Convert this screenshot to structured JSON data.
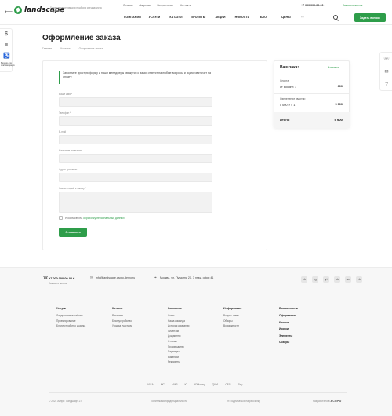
{
  "header": {
    "back_arrow": "⟵",
    "logo_text": "landscape",
    "tagline": "Готовые решения для подбора специалиста по дизайну",
    "top_links": [
      "Отзывы",
      "Лицензии",
      "Вопрос-ответ",
      "Контакты"
    ],
    "phone": "+7 000 000-00-00 ▾",
    "callback": "Заказать звонок",
    "nav": [
      "КОМПАНИЯ",
      "УСЛУГИ",
      "КАТАЛОГ",
      "ПРОЕКТЫ",
      "АКЦИИ",
      "НОВОСТИ",
      "БЛОГ",
      "ЦЕНЫ",
      "···"
    ],
    "order_button": "Задать вопрос"
  },
  "side_tools": {
    "left": [
      {
        "icon": "currency-icon",
        "glyph": "$"
      },
      {
        "icon": "filter-icon",
        "glyph": "≡"
      },
      {
        "icon": "accessibility-icon",
        "glyph": "♿"
      }
    ],
    "left_label": "Версия для слабовидящих"
  },
  "page": {
    "title": "Оформление заказа",
    "breadcrumb": [
      "Главная",
      "—",
      "Корзина",
      "—",
      "Оформление заказа"
    ]
  },
  "form": {
    "intro": "Заполните простую форму и наши менеджеры свяжутся с вами, ответят на любые вопросы и подготовят счет на оплату.",
    "fields": [
      {
        "label": "Ваше имя *"
      },
      {
        "label": "Телефон *"
      },
      {
        "label": "E-mail"
      },
      {
        "label": "Название компании"
      },
      {
        "label": "Адрес доставки"
      },
      {
        "label": "Комментарий к заказу *"
      }
    ],
    "consent_prefix": "Я согласен на",
    "consent_link": "обработку персональных данных",
    "submit": "Отправить"
  },
  "summary": {
    "title": "Ваш заказ",
    "edit": "Изменить",
    "items": [
      {
        "name": "Спорта",
        "qty": "от 600 ₽ × 1",
        "price": "600"
      },
      {
        "name": "Озеленение квартир",
        "qty": "5 000 ₽ × 1",
        "price": "5 000"
      }
    ],
    "total_label": "Итого:",
    "total_value": "5 600"
  },
  "footer": {
    "phone": "+7 000 000-00-00 ▾",
    "callback": "Заказать звонок",
    "email": "info@landscape.aspro-demo.ru",
    "address": "Москва, ул. Пушкина 21, 3 этаж, офис 41",
    "socials": [
      "vk",
      "tg",
      "yt",
      "ok",
      "wa",
      "vb"
    ],
    "columns": [
      {
        "title": "Услуги",
        "links": [
          "Ландшафтные работы",
          "Проектирование",
          "Благоустройство участка"
        ]
      },
      {
        "title": "Каталог",
        "links": [
          "Растения",
          "Благоустройство",
          "Уход за участком"
        ]
      },
      {
        "title": "Компания",
        "links": [
          "О нас",
          "Наша команда",
          "История компании",
          "Лицензии",
          "Документы",
          "Отзывы",
          "Производство",
          "Партнеры",
          "Вакансии",
          "Реквизиты"
        ]
      },
      {
        "title": "Информация",
        "links": [
          "Вопрос-ответ",
          "Обзоры",
          "Возможности"
        ]
      },
      {
        "title": "Возможности",
        "links": [
          "Оформление",
          "Кнопки",
          "Иконки",
          "Элементы",
          "Обзоры"
        ]
      }
    ],
    "payments": [
      "VISA",
      "MC",
      "МИР",
      "Ю",
      "ЮMoney",
      "QIWI",
      "СБП",
      "Pay"
    ],
    "copyright": "© 2024 Аспро: Ландшафт 2.0",
    "privacy": "Политика конфиденциальности",
    "subscribe": "Подписаться на рассылку",
    "dev_prefix": "Разработано в",
    "dev_brand": "АСПРО"
  },
  "colors": {
    "accent": "#2e9d4a"
  }
}
